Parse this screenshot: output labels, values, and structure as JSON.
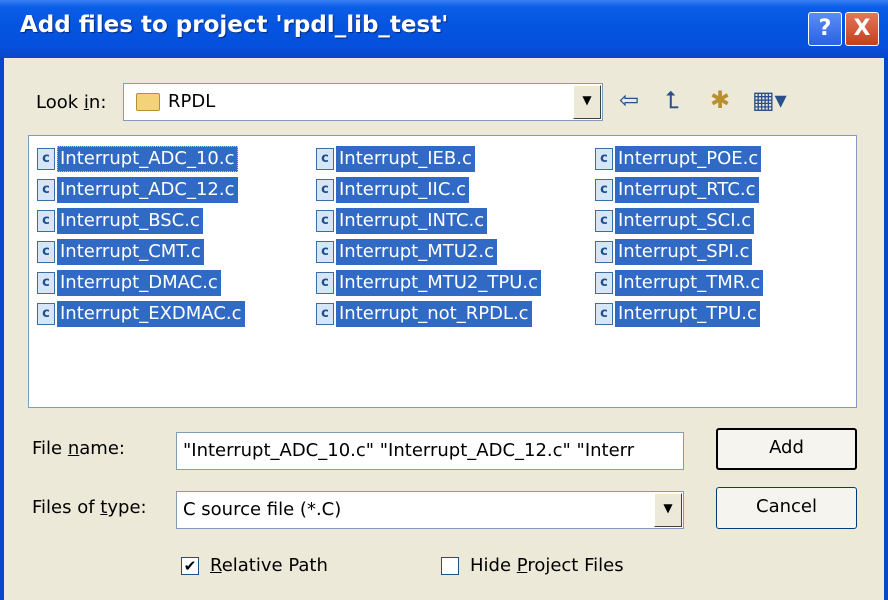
{
  "window": {
    "title": "Add files to project 'rpdl_lib_test'",
    "help_glyph": "?",
    "close_glyph": "X"
  },
  "look_in": {
    "label_before": "Look ",
    "label_ul": "i",
    "label_after": "n:",
    "value": "RPDL",
    "dropdown_glyph": "▼"
  },
  "toolbar": {
    "back_glyph": "⇦",
    "up_folder_glyph": "⮤",
    "new_folder_glyph": "✱",
    "view_menu_glyph": "▦▾"
  },
  "files": [
    [
      "Interrupt_ADC_10.c",
      "Interrupt_IEB.c",
      "Interrupt_POE.c"
    ],
    [
      "Interrupt_ADC_12.c",
      "Interrupt_IIC.c",
      "Interrupt_RTC.c"
    ],
    [
      "Interrupt_BSC.c",
      "Interrupt_INTC.c",
      "Interrupt_SCI.c"
    ],
    [
      "Interrupt_CMT.c",
      "Interrupt_MTU2.c",
      "Interrupt_SPI.c"
    ],
    [
      "Interrupt_DMAC.c",
      "Interrupt_MTU2_TPU.c",
      "Interrupt_TMR.c"
    ],
    [
      "Interrupt_EXDMAC.c",
      "Interrupt_not_RPDL.c",
      "Interrupt_TPU.c"
    ]
  ],
  "file_icon_glyph": "c",
  "file_name": {
    "label_before": "File ",
    "label_ul": "n",
    "label_after": "ame:",
    "value": "\"Interrupt_ADC_10.c\" \"Interrupt_ADC_12.c\" \"Interr"
  },
  "file_type": {
    "label_before": "Files of ",
    "label_ul": "t",
    "label_after": "ype:",
    "value": "C source file (*.C)",
    "dropdown_glyph": "▼"
  },
  "buttons": {
    "add": "Add",
    "cancel": "Cancel"
  },
  "options": {
    "relative_path": {
      "ul": "R",
      "rest": "elative Path",
      "checked_glyph": "✔"
    },
    "hide_project_files": {
      "before": "Hide ",
      "ul": "P",
      "after": "roject Files"
    }
  }
}
